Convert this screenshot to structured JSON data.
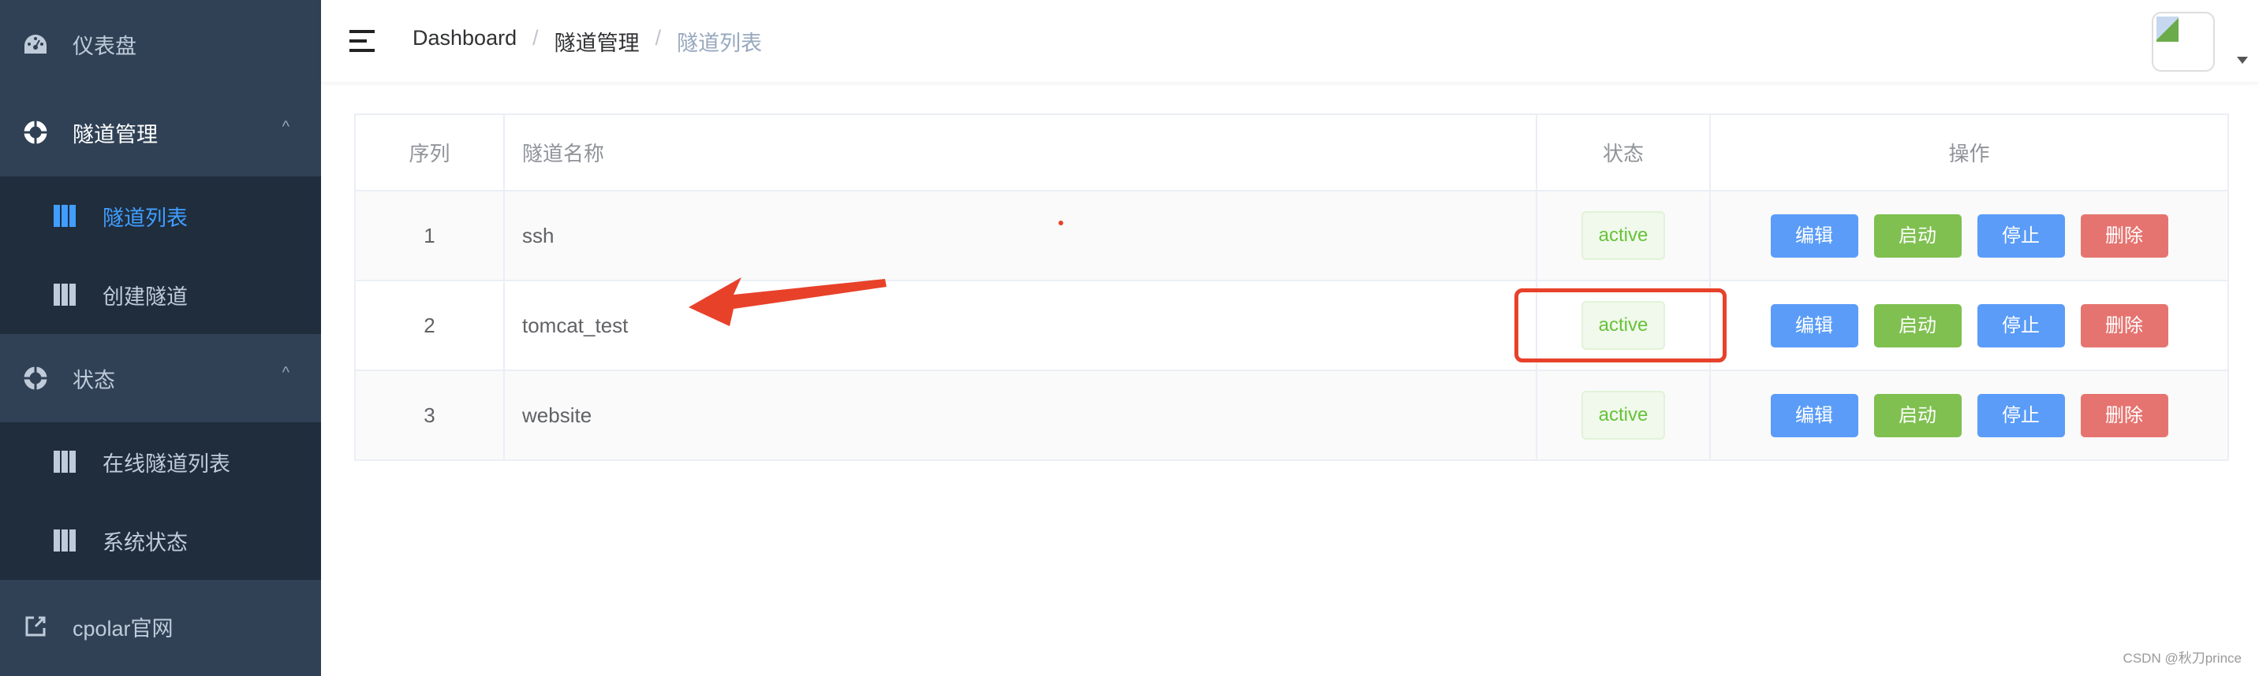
{
  "sidebar": {
    "items": [
      {
        "label": "仪表盘",
        "icon": "dashboard-icon"
      },
      {
        "label": "隧道管理",
        "icon": "lifebuoy-icon",
        "expanded": true,
        "children": [
          {
            "label": "隧道列表",
            "active": true
          },
          {
            "label": "创建隧道"
          }
        ]
      },
      {
        "label": "状态",
        "icon": "lifebuoy-icon",
        "expanded": true,
        "children": [
          {
            "label": "在线隧道列表"
          },
          {
            "label": "系统状态"
          }
        ]
      },
      {
        "label": "cpolar官网",
        "icon": "external-link-icon"
      }
    ]
  },
  "header": {
    "breadcrumb": [
      "Dashboard",
      "隧道管理",
      "隧道列表"
    ],
    "separator": "/"
  },
  "table": {
    "columns": [
      "序列",
      "隧道名称",
      "状态",
      "操作"
    ],
    "rows": [
      {
        "index": "1",
        "name": "ssh",
        "status": "active"
      },
      {
        "index": "2",
        "name": "tomcat_test",
        "status": "active"
      },
      {
        "index": "3",
        "name": "website",
        "status": "active"
      }
    ],
    "actions": [
      "编辑",
      "启动",
      "停止",
      "删除"
    ]
  },
  "colors": {
    "sidebar": "#304156",
    "submenu": "#1f2d3d",
    "active": "#409eff",
    "edit": "#5a9cf8",
    "start": "#7fc050",
    "stop": "#5a9cf8",
    "delete": "#e57470",
    "annotation": "#e8412a"
  },
  "watermark": "CSDN @秋刀prince"
}
